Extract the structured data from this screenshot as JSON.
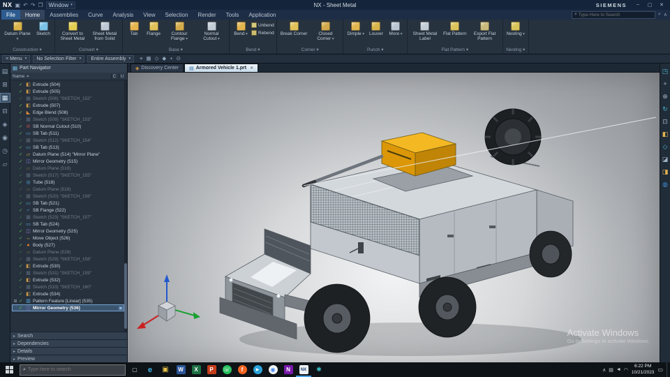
{
  "theme": {
    "titlebar-bg": "#14243a",
    "menubar-bg": "#1d2d46",
    "ribbon-bg": "#27323f",
    "ribbon-label": "#8b99a9",
    "chrome-border": "#0c141e",
    "panel-bg": "#2b3542",
    "panel-head": "#33404f",
    "tree-bg": "#27313d",
    "text": "#c7d1db",
    "dim": "#717d8a",
    "accent": "#3f8cca",
    "select-bg": "#3c556f",
    "taskbar-bg": "#0e1317"
  },
  "titlebar": {
    "app": "NX",
    "title": "NX - Sheet Metal",
    "brand": "SIEMENS",
    "window_menu": "Window",
    "icons": [
      {
        "name": "save-icon",
        "glyph": "▣"
      },
      {
        "name": "undo-icon",
        "glyph": "↶"
      },
      {
        "name": "redo-icon",
        "glyph": "↷"
      },
      {
        "name": "window-switch-icon",
        "glyph": "❒"
      }
    ],
    "window_controls": [
      {
        "name": "minimize-icon",
        "glyph": "–"
      },
      {
        "name": "maximize-icon",
        "glyph": "▢"
      },
      {
        "name": "close-icon",
        "glyph": "✕"
      }
    ]
  },
  "menubar": {
    "tabs": [
      {
        "label": "File",
        "accent": true
      },
      {
        "label": "Home",
        "active": true
      },
      {
        "label": "Assemblies"
      },
      {
        "label": "Curve"
      },
      {
        "label": "Analysis"
      },
      {
        "label": "View"
      },
      {
        "label": "Selection"
      },
      {
        "label": "Render"
      },
      {
        "label": "Tools"
      },
      {
        "label": "Application"
      }
    ],
    "search_placeholder": "Type Here to Search",
    "right_icons": [
      {
        "name": "command-finder-icon",
        "glyph": "⌕"
      },
      {
        "name": "minimize-ribbon-icon",
        "glyph": "∧"
      }
    ]
  },
  "ribbon": {
    "groups": [
      {
        "label": "Construction",
        "buttons": [
          {
            "label": "Datum Plane",
            "arrow": true,
            "color": "#d9b44a"
          },
          {
            "label": "Sketch",
            "color": "#7ac2e8"
          }
        ]
      },
      {
        "label": "Convert",
        "buttons": [
          {
            "label": "Convert to Sheet Metal",
            "color": "#e3cf52"
          },
          {
            "label": "Sheet Metal from Solid",
            "color": "#bcc8d4"
          }
        ]
      },
      {
        "label": "Base",
        "buttons": [
          {
            "label": "Tab",
            "color": "#e4b44e"
          },
          {
            "label": "Flange",
            "color": "#e0c258"
          },
          {
            "label": "Contour Flange",
            "arrow": true,
            "color": "#d4ab4a"
          },
          {
            "label": "Normal Cutout",
            "arrow": true,
            "color": "#c3cdd6"
          }
        ]
      },
      {
        "label": "Bend",
        "buttons": [
          {
            "label": "Bend",
            "arrow": true,
            "color": "#e2b54e"
          }
        ],
        "small": [
          {
            "label": "Unbend",
            "color": "#d7c87c"
          },
          {
            "label": "Rebend",
            "color": "#cdbd6e"
          }
        ]
      },
      {
        "label": "Corner",
        "buttons": [
          {
            "label": "Break Corner",
            "color": "#e0c258"
          },
          {
            "label": "Closed Corner",
            "arrow": true,
            "color": "#d2a94a"
          }
        ]
      },
      {
        "label": "Punch",
        "buttons": [
          {
            "label": "Dimple",
            "arrow": true,
            "color": "#e2b54e"
          },
          {
            "label": "Louver",
            "color": "#d9b44a"
          },
          {
            "label": "More",
            "arrow": true,
            "color": "#b9c5d2"
          }
        ]
      },
      {
        "label": "Flat Pattern",
        "buttons": [
          {
            "label": "Sheet Metal Label",
            "color": "#c3cdd6"
          },
          {
            "label": "Flat Pattern",
            "color": "#dcc25a"
          },
          {
            "label": "Export Flat Pattern",
            "color": "#c9b97a"
          }
        ]
      },
      {
        "label": "Nesting",
        "buttons": [
          {
            "label": "Nesting",
            "arrow": true,
            "color": "#d9c45a"
          }
        ]
      }
    ]
  },
  "toolbar": {
    "menu_label": "Menu",
    "selection_filter": "No Selection Filter",
    "scope": "Entire Assembly",
    "icons": [
      {
        "name": "snap-point-icon",
        "glyph": "⌖"
      },
      {
        "name": "grid-snap-icon",
        "glyph": "▦"
      },
      {
        "name": "endpoint-snap-icon",
        "glyph": "◇"
      },
      {
        "name": "midpoint-snap-icon",
        "glyph": "◆"
      },
      {
        "name": "intersection-snap-icon",
        "glyph": "+"
      },
      {
        "name": "center-snap-icon",
        "glyph": "⊙"
      }
    ]
  },
  "doc_tabs": {
    "items": [
      {
        "label": "Discovery Center",
        "icon_name": "discovery-center-icon",
        "icon_glyph": "◈",
        "icon_color": "#e8a43a"
      },
      {
        "label": "Armored Vehicle 1.prt",
        "active": true,
        "closable": true,
        "icon_name": "part-file-icon",
        "icon_glyph": "▤",
        "icon_color": "#2f6da8"
      }
    ]
  },
  "left_dock": [
    {
      "name": "assembly-navigator-icon",
      "glyph": "▤"
    },
    {
      "name": "constraint-navigator-icon",
      "glyph": "⊞"
    },
    {
      "name": "part-navigator-icon",
      "glyph": "▦",
      "active": true
    },
    {
      "name": "reuse-library-icon",
      "glyph": "⊟"
    },
    {
      "name": "hd3d-tools-icon",
      "glyph": "◈"
    },
    {
      "name": "web-browser-icon",
      "glyph": "◉"
    },
    {
      "name": "history-icon",
      "glyph": "◷"
    },
    {
      "name": "process-studio-icon",
      "glyph": "▱"
    }
  ],
  "right_dock": [
    {
      "name": "view-cube-icon",
      "glyph": "◳",
      "color": "#49b6c8"
    },
    {
      "name": "pan-view-icon",
      "glyph": "+",
      "color": "#9fb3c3"
    },
    {
      "name": "zoom-view-icon",
      "glyph": "⊕",
      "color": "#9fb3c3"
    },
    {
      "name": "rotate-view-icon",
      "glyph": "↻",
      "color": "#49b6c8"
    },
    {
      "name": "fit-view-icon",
      "glyph": "⊡",
      "color": "#9fb3c3"
    },
    {
      "name": "shaded-view-icon",
      "glyph": "◧",
      "color": "#e3b44e"
    },
    {
      "name": "wireframe-view-icon",
      "glyph": "◇",
      "color": "#49b6c8"
    },
    {
      "name": "section-view-icon",
      "glyph": "◪",
      "color": "#9fb3c3"
    },
    {
      "name": "perspective-view-icon",
      "glyph": "◨",
      "color": "#e3b44e"
    },
    {
      "name": "render-style-icon",
      "glyph": "◍",
      "color": "#3f8cca"
    }
  ],
  "part_navigator": {
    "title": "Part Navigator",
    "name_column": "Name",
    "sort_glyph": "▲",
    "col_c": "C",
    "col_u": "U",
    "items": [
      {
        "label": "Extrude (504)",
        "icon": "extrude"
      },
      {
        "label": "Extrude (505)",
        "icon": "extrude"
      },
      {
        "label": "Sketch (506) \"SKETCH_152\"",
        "icon": "sketch",
        "dim": true
      },
      {
        "label": "Extrude (507)",
        "icon": "extrude"
      },
      {
        "label": "Edge Blend (508)",
        "icon": "edge-blend"
      },
      {
        "label": "Sketch (509) \"SKETCH_153\"",
        "icon": "sketch",
        "dim": true
      },
      {
        "label": "SB Normal Cutout (510)",
        "icon": "cutout"
      },
      {
        "label": "SB Tab (511)",
        "icon": "sb-tab"
      },
      {
        "label": "Sketch (512) \"SKETCH_154\"",
        "icon": "sketch",
        "dim": true
      },
      {
        "label": "SB Tab (513)",
        "icon": "sb-tab"
      },
      {
        "label": "Datum Plane (514) \"Mirror Plane\"",
        "icon": "datum"
      },
      {
        "label": "Mirror Geometry (515)",
        "icon": "mirror"
      },
      {
        "label": "Datum Plane (516)",
        "icon": "datum",
        "dim": true
      },
      {
        "label": "Sketch (517) \"SKETCH_155\"",
        "icon": "sketch",
        "dim": true
      },
      {
        "label": "Tube (518)",
        "icon": "tube"
      },
      {
        "label": "Datum Plane (519)",
        "icon": "datum",
        "dim": true
      },
      {
        "label": "Sketch (520) \"SKETCH_156\"",
        "icon": "sketch",
        "dim": true
      },
      {
        "label": "SB Tab (521)",
        "icon": "sb-tab"
      },
      {
        "label": "SB Flange (522)",
        "icon": "sb-flange"
      },
      {
        "label": "Sketch (523) \"SKETCH_157\"",
        "icon": "sketch",
        "dim": true
      },
      {
        "label": "SB Tab (524)",
        "icon": "sb-tab"
      },
      {
        "label": "Mirror Geometry (525)",
        "icon": "mirror"
      },
      {
        "label": "Move Object (526)",
        "icon": "move"
      },
      {
        "label": "Body (527)",
        "icon": "body"
      },
      {
        "label": "Datum Plane (528)",
        "icon": "datum",
        "dim": true
      },
      {
        "label": "Sketch (529) \"SKETCH_158\"",
        "icon": "sketch",
        "dim": true
      },
      {
        "label": "Extrude (530)",
        "icon": "extrude"
      },
      {
        "label": "Sketch (531) \"SKETCH_159\"",
        "icon": "sketch",
        "dim": true
      },
      {
        "label": "Extrude (532)",
        "icon": "extrude"
      },
      {
        "label": "Sketch (533) \"SKETCH_160\"",
        "icon": "sketch",
        "dim": true
      },
      {
        "label": "Extrude (534)",
        "icon": "extrude"
      },
      {
        "label": "Pattern Feature [Linear] (535)",
        "icon": "pattern",
        "expand": true
      },
      {
        "label": "Mirror Geometry (536)",
        "icon": "mirror",
        "selected": true
      }
    ],
    "sections": [
      "Search",
      "Dependencies",
      "Details",
      "Preview"
    ]
  },
  "canvas": {
    "watermark_line1": "Activate Windows",
    "watermark_line2": "Go to Settings to activate Windows."
  },
  "taskbar": {
    "search_placeholder": "Type here to search",
    "icons": [
      {
        "name": "task-view-icon",
        "glyph": "▢",
        "fg": "#ccd3d9"
      },
      {
        "name": "edge-icon",
        "glyph": "e",
        "fg": "#3fb6e8",
        "size": 11
      },
      {
        "name": "file-explorer-icon",
        "glyph": "▣",
        "fg": "#e9c44a",
        "size": 10
      },
      {
        "name": "word-icon",
        "glyph": "W",
        "bg": "#2b579a",
        "fg": "#ffffff"
      },
      {
        "name": "excel-icon",
        "glyph": "X",
        "bg": "#1e7145",
        "fg": "#ffffff"
      },
      {
        "name": "powerpoint-icon",
        "glyph": "P",
        "bg": "#c43e1c",
        "fg": "#ffffff"
      },
      {
        "name": "whatsapp-icon",
        "glyph": "☏",
        "bg": "#25c15e",
        "fg": "#ffffff",
        "round": true
      },
      {
        "name": "firefox-icon",
        "glyph": "f",
        "bg": "#f26522",
        "fg": "#ffffff",
        "round": true
      },
      {
        "name": "telegram-icon",
        "glyph": "▶",
        "bg": "#29a3d8",
        "fg": "#ffffff",
        "round": true,
        "size": 6
      },
      {
        "name": "chrome-icon",
        "glyph": "◉",
        "bg": "#f1f3f4",
        "fg": "#4285f4",
        "round": true
      },
      {
        "name": "onenote-icon",
        "glyph": "N",
        "bg": "#7719aa",
        "fg": "#ffffff"
      },
      {
        "name": "nx-icon",
        "glyph": "NX",
        "bg": "#eef2f6",
        "fg": "#1a3a6b",
        "running": true,
        "size": 6
      },
      {
        "name": "settings-icon",
        "glyph": "✱",
        "fg": "#3ac0c8",
        "size": 9
      }
    ],
    "tray_icons": [
      {
        "name": "tray-expand-icon",
        "glyph": "∧"
      },
      {
        "name": "display-icon",
        "glyph": "▤"
      },
      {
        "name": "volume-icon",
        "glyph": "◄"
      },
      {
        "name": "network-icon",
        "glyph": "◠"
      }
    ],
    "time": "6:22 PM",
    "date": "10/21/2023"
  }
}
